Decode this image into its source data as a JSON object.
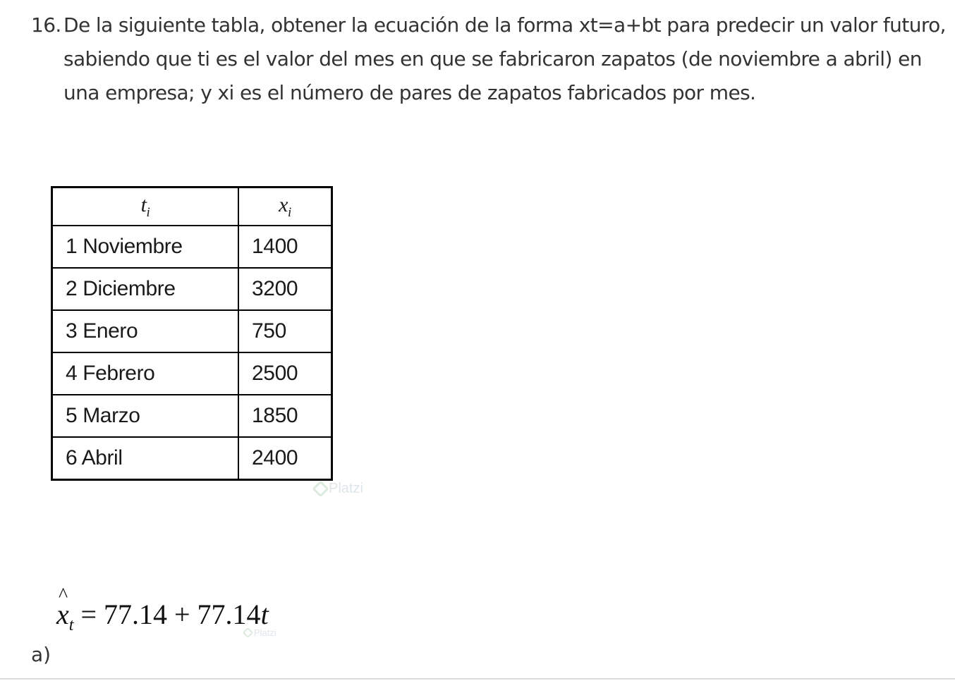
{
  "question": {
    "number": "16.",
    "lines": [
      "De la siguiente tabla, obtener la ecuación de la forma xt=a+bt para predecir un valor futuro,",
      "sabiendo que ti es el valor del mes en que se fabricaron zapatos (de noviembre a abril) en",
      "una empresa; y xi es el número de pares de zapatos fabricados por mes."
    ]
  },
  "table": {
    "headers": [
      {
        "var": "t",
        "sub": "i"
      },
      {
        "var": "x",
        "sub": "i"
      }
    ],
    "rows": [
      [
        "1 Noviembre",
        "1400"
      ],
      [
        "2 Diciembre",
        "3200"
      ],
      [
        "3 Enero",
        "750"
      ],
      [
        "4 Febrero",
        "2500"
      ],
      [
        "5 Marzo",
        "1850"
      ],
      [
        "6 Abril",
        "2400"
      ]
    ]
  },
  "watermark": {
    "text": "Platzi",
    "icon": "platzi-logo-icon"
  },
  "option": {
    "label": "a)",
    "formula": {
      "var": "x",
      "hat": "^",
      "sub": "t",
      "rhs": " = 77.14 + 77.14",
      "tvar": "t"
    }
  }
}
